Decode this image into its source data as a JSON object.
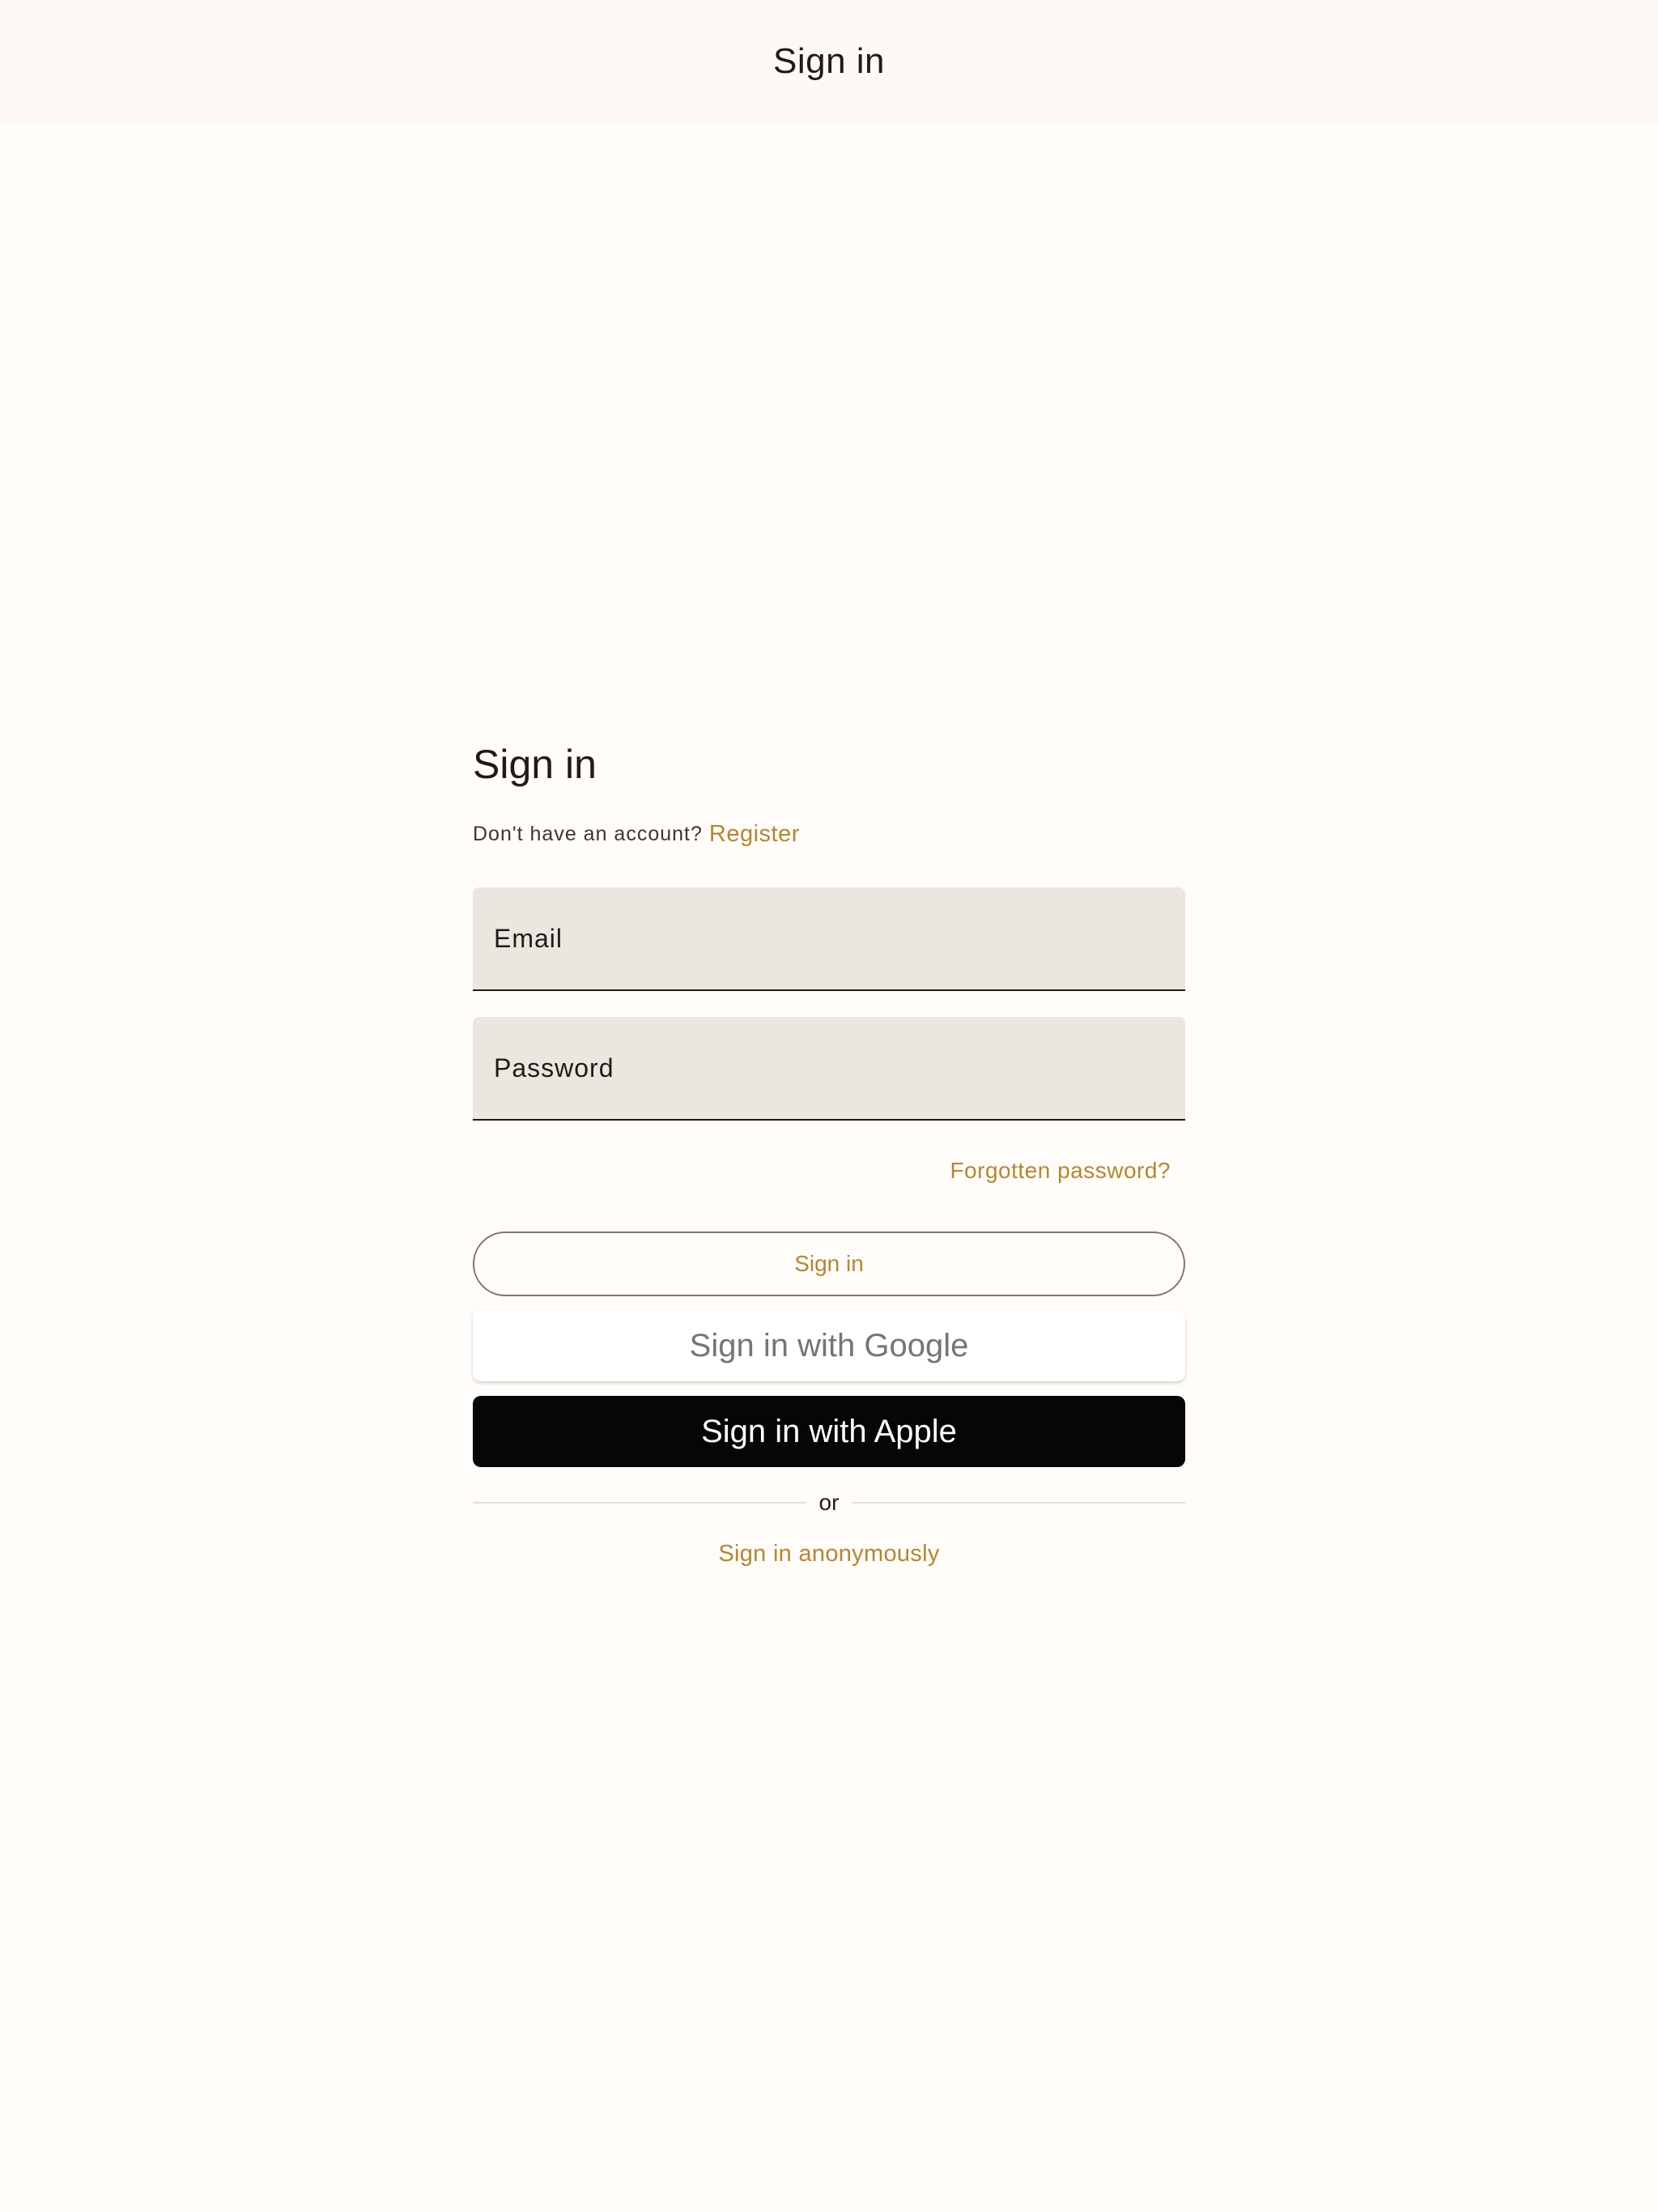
{
  "app_bar": {
    "title": "Sign in"
  },
  "form": {
    "title": "Sign in",
    "register_prompt": "Don't have an account?",
    "register_link": "Register",
    "email_placeholder": "Email",
    "password_placeholder": "Password",
    "forgot_password": "Forgotten password?",
    "sign_in_button": "Sign in",
    "google_button": "Sign in with Google",
    "apple_button": "Sign in with Apple",
    "divider_text": "or",
    "anonymous_link": "Sign in anonymously"
  },
  "colors": {
    "background": "#fffcfa",
    "accent": "#b8862b",
    "field_fill": "#ebe6e0",
    "apple_button": "#050607"
  }
}
